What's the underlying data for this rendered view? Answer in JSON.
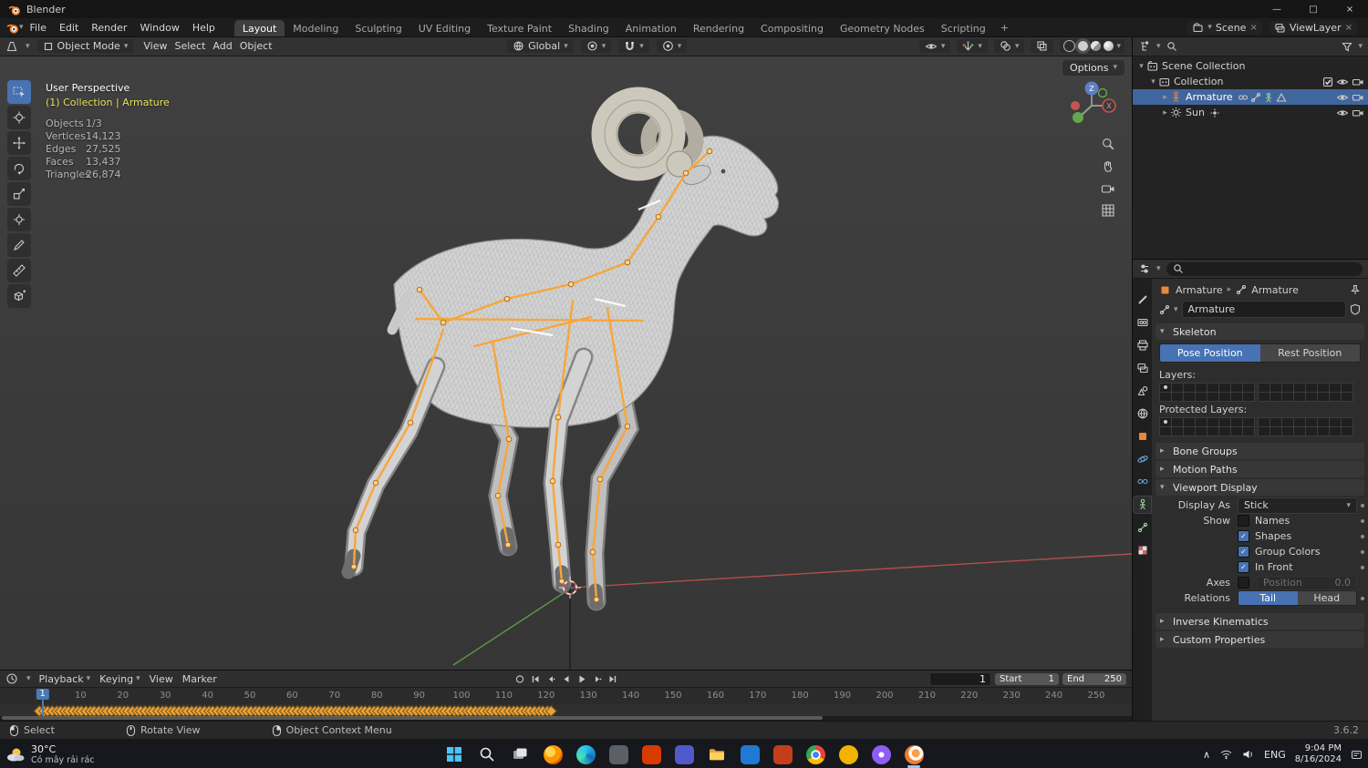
{
  "icons_text": {
    "dropdown": "▾",
    "expand": "▸",
    "collapse": "▾",
    "close": "×",
    "minimize": "—",
    "maximize": "□",
    "chevron_up": "∧",
    "breadcrumb_sep": "›",
    "check": "✓",
    "plus": "+"
  },
  "window": {
    "title": "Blender"
  },
  "menubar": {
    "menus": [
      "File",
      "Edit",
      "Render",
      "Window",
      "Help"
    ],
    "workspaces": [
      "Layout",
      "Modeling",
      "Sculpting",
      "UV Editing",
      "Texture Paint",
      "Shading",
      "Animation",
      "Rendering",
      "Compositing",
      "Geometry Nodes",
      "Scripting"
    ],
    "active_workspace": "Layout",
    "add_workspace_label": "+",
    "scene_name": "Scene",
    "view_layer_name": "ViewLayer"
  },
  "viewport_header": {
    "mode": "Object Mode",
    "menus": [
      "View",
      "Select",
      "Add",
      "Object"
    ],
    "orientation": "Global",
    "options_label": "Options"
  },
  "tools": [
    {
      "name": "select-box-tool",
      "active": true
    },
    {
      "name": "cursor-tool"
    },
    {
      "name": "move-tool"
    },
    {
      "name": "rotate-tool"
    },
    {
      "name": "scale-tool"
    },
    {
      "name": "transform-tool"
    },
    {
      "name": "annotate-tool"
    },
    {
      "name": "measure-tool"
    },
    {
      "name": "add-cube-tool"
    }
  ],
  "viewport_overlay": {
    "view_name": "User Perspective",
    "active_object": "(1) Collection | Armature",
    "stats": [
      {
        "label": "Objects",
        "value": "1/3"
      },
      {
        "label": "Vertices",
        "value": "14,123"
      },
      {
        "label": "Edges",
        "value": "27,525"
      },
      {
        "label": "Faces",
        "value": "13,437"
      },
      {
        "label": "Triangles",
        "value": "26,874"
      }
    ],
    "gizmo": {
      "z_label": "Z",
      "x_label": "X"
    }
  },
  "outliner": {
    "rows": [
      {
        "label": "Scene Collection",
        "icon": "scene-collection-icon",
        "arrow": "collapse",
        "depth": 0,
        "inline_icons": [],
        "right_icons": []
      },
      {
        "label": "Collection",
        "icon": "collection-icon",
        "arrow": "collapse",
        "depth": 1,
        "inline_icons": [],
        "right_icons": [
          "checkbox-icon",
          "eye-icon",
          "camera-icon"
        ]
      },
      {
        "label": "Armature",
        "icon": "armature-object-icon",
        "arrow": "expand",
        "depth": 2,
        "selected": true,
        "inline_icons": [
          "constraint-icon",
          "armature-data-icon",
          "pose-icon",
          "mesh-data-icon"
        ],
        "right_icons": [
          "eye-icon",
          "camera-icon"
        ]
      },
      {
        "label": "Sun",
        "icon": "sun-object-icon",
        "arrow": "expand",
        "depth": 2,
        "inline_icons": [
          "light-data-icon"
        ],
        "right_icons": [
          "eye-icon",
          "camera-icon"
        ]
      }
    ]
  },
  "properties": {
    "breadcrumb": {
      "object": "Armature",
      "data": "Armature"
    },
    "name_value": "Armature",
    "tabs": [
      "tool",
      "render",
      "output",
      "view-layer",
      "scene",
      "world",
      "object",
      "physics",
      "constraints",
      "object-data",
      "bone",
      "texture"
    ],
    "active_tab": "object-data",
    "skeleton": {
      "title": "Skeleton",
      "pose_position_label": "Pose Position",
      "rest_position_label": "Rest Position",
      "active_position": "Pose Position",
      "layers_label": "Layers:",
      "protected_layers_label": "Protected Layers:"
    },
    "collapsed_sections": [
      "Bone Groups",
      "Motion Paths"
    ],
    "viewport_display": {
      "title": "Viewport Display",
      "display_as_label": "Display As",
      "display_as_value": "Stick",
      "show_label": "Show",
      "toggles": [
        {
          "label": "Names",
          "checked": false
        },
        {
          "label": "Shapes",
          "checked": true
        },
        {
          "label": "Group Colors",
          "checked": true
        },
        {
          "label": "In Front",
          "checked": true
        }
      ],
      "axes_label": "Axes",
      "axes_checked": false,
      "position_label": "Position",
      "position_value": "0.0",
      "relations_label": "Relations",
      "relations_options": [
        "Tail",
        "Head"
      ],
      "relations_active": "Tail"
    },
    "collapsed_sections_bottom": [
      "Inverse Kinematics",
      "Custom Properties"
    ]
  },
  "timeline": {
    "menus": [
      {
        "label": "Playback",
        "dropdown": true
      },
      {
        "label": "Keying",
        "dropdown": true
      },
      {
        "label": "View",
        "dropdown": false
      },
      {
        "label": "Marker",
        "dropdown": false
      }
    ],
    "transport": [
      "auto-key",
      "jump-first",
      "prev-key",
      "play-reverse",
      "play",
      "next-key",
      "jump-last"
    ],
    "current_frame": "1",
    "start_label": "Start",
    "start_value": "1",
    "end_label": "End",
    "end_value": "250",
    "tick_min": 10,
    "tick_max": 250,
    "tick_step": 10,
    "keyframes": {
      "first": 0,
      "last": 121
    }
  },
  "statusbar": {
    "hints": [
      {
        "icon": "mouse-left-icon",
        "label": "Select"
      },
      {
        "icon": "mouse-middle-icon",
        "label": "Rotate View"
      },
      {
        "icon": "mouse-right-icon",
        "label": "Object Context Menu"
      }
    ],
    "version": "3.6.2"
  },
  "taskbar": {
    "weather": {
      "temp": "30°C",
      "desc": "Có mây rải rác"
    },
    "apps": [
      {
        "name": "start"
      },
      {
        "name": "search"
      },
      {
        "name": "task-view"
      },
      {
        "name": "firefox"
      },
      {
        "name": "edge"
      },
      {
        "name": "notepad"
      },
      {
        "name": "office"
      },
      {
        "name": "teams"
      },
      {
        "name": "file-explorer"
      },
      {
        "name": "photos"
      },
      {
        "name": "powerpoint"
      },
      {
        "name": "chrome"
      },
      {
        "name": "chrome-beta"
      },
      {
        "name": "viber"
      },
      {
        "name": "blender",
        "active": true
      }
    ],
    "tray": {
      "language": "ENG",
      "time": "9:04 PM",
      "date": "8/16/2024"
    }
  }
}
